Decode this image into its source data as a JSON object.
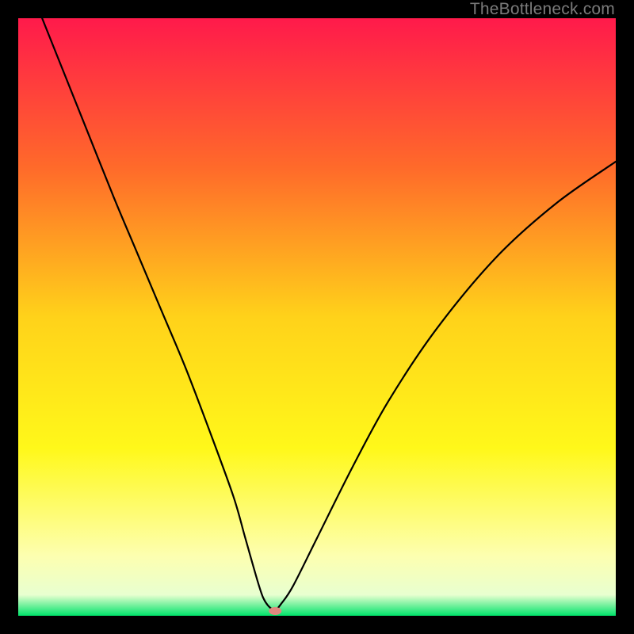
{
  "watermark": "TheBottleneck.com",
  "chart_data": {
    "type": "line",
    "title": "",
    "xlabel": "",
    "ylabel": "",
    "xlim": [
      0,
      100
    ],
    "ylim": [
      0,
      100
    ],
    "grid": false,
    "legend": false,
    "background_gradient": {
      "stops": [
        {
          "offset": 0.0,
          "color": "#ff1a4b"
        },
        {
          "offset": 0.25,
          "color": "#ff6a2a"
        },
        {
          "offset": 0.5,
          "color": "#ffd21a"
        },
        {
          "offset": 0.72,
          "color": "#fff81a"
        },
        {
          "offset": 0.9,
          "color": "#fdffb0"
        },
        {
          "offset": 0.965,
          "color": "#e8ffd0"
        },
        {
          "offset": 1.0,
          "color": "#00e36a"
        }
      ]
    },
    "series": [
      {
        "name": "bottleneck-curve",
        "x": [
          4,
          8,
          12,
          16,
          20,
          24,
          28,
          32,
          36,
          38,
          40,
          41,
          42,
          43,
          44,
          46,
          50,
          56,
          62,
          70,
          80,
          90,
          100
        ],
        "y": [
          100,
          90,
          80,
          70,
          60.5,
          51,
          41.5,
          31,
          20,
          13,
          6,
          3,
          1.5,
          1,
          2,
          5,
          13,
          25,
          36,
          48,
          60,
          69,
          76
        ]
      }
    ],
    "marker": {
      "x": 43,
      "y": 0.8,
      "color": "#e0887f",
      "rx": 8,
      "ry": 5
    }
  }
}
